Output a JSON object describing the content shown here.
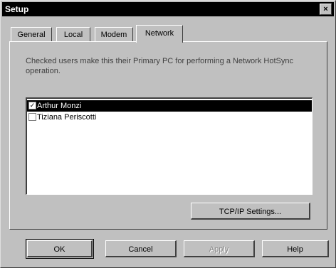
{
  "window": {
    "title": "Setup",
    "close_glyph": "×"
  },
  "tabs": [
    {
      "label": "General"
    },
    {
      "label": "Local"
    },
    {
      "label": "Modem"
    },
    {
      "label": "Network",
      "active": true
    }
  ],
  "network": {
    "description": "Checked users make this their Primary PC for performing a Network HotSync operation.",
    "users": [
      {
        "name": "Arthur Monzi",
        "checked": true,
        "selected": true
      },
      {
        "name": "Tiziana Periscotti",
        "checked": false,
        "selected": false
      }
    ],
    "tcpip_button": "TCP/IP Settings..."
  },
  "footer": {
    "ok": "OK",
    "cancel": "Cancel",
    "apply": "Apply",
    "help": "Help"
  },
  "checkmark_glyph": "✓"
}
